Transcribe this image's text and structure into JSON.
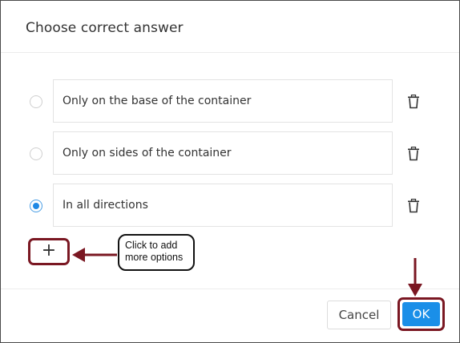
{
  "dialog": {
    "title": "Choose correct answer"
  },
  "options": [
    {
      "label": "Only on the base of the container",
      "selected": false
    },
    {
      "label": "Only on sides of the container",
      "selected": false
    },
    {
      "label": "In all directions",
      "selected": true
    }
  ],
  "add_button": {
    "label": "+"
  },
  "callout": {
    "line1": "Click to add",
    "line2": "more options"
  },
  "footer": {
    "cancel_label": "Cancel",
    "ok_label": "OK"
  },
  "colors": {
    "accent": "#1a8fe8",
    "annotation": "#7a1722"
  },
  "icons": {
    "delete": "trash-icon"
  }
}
